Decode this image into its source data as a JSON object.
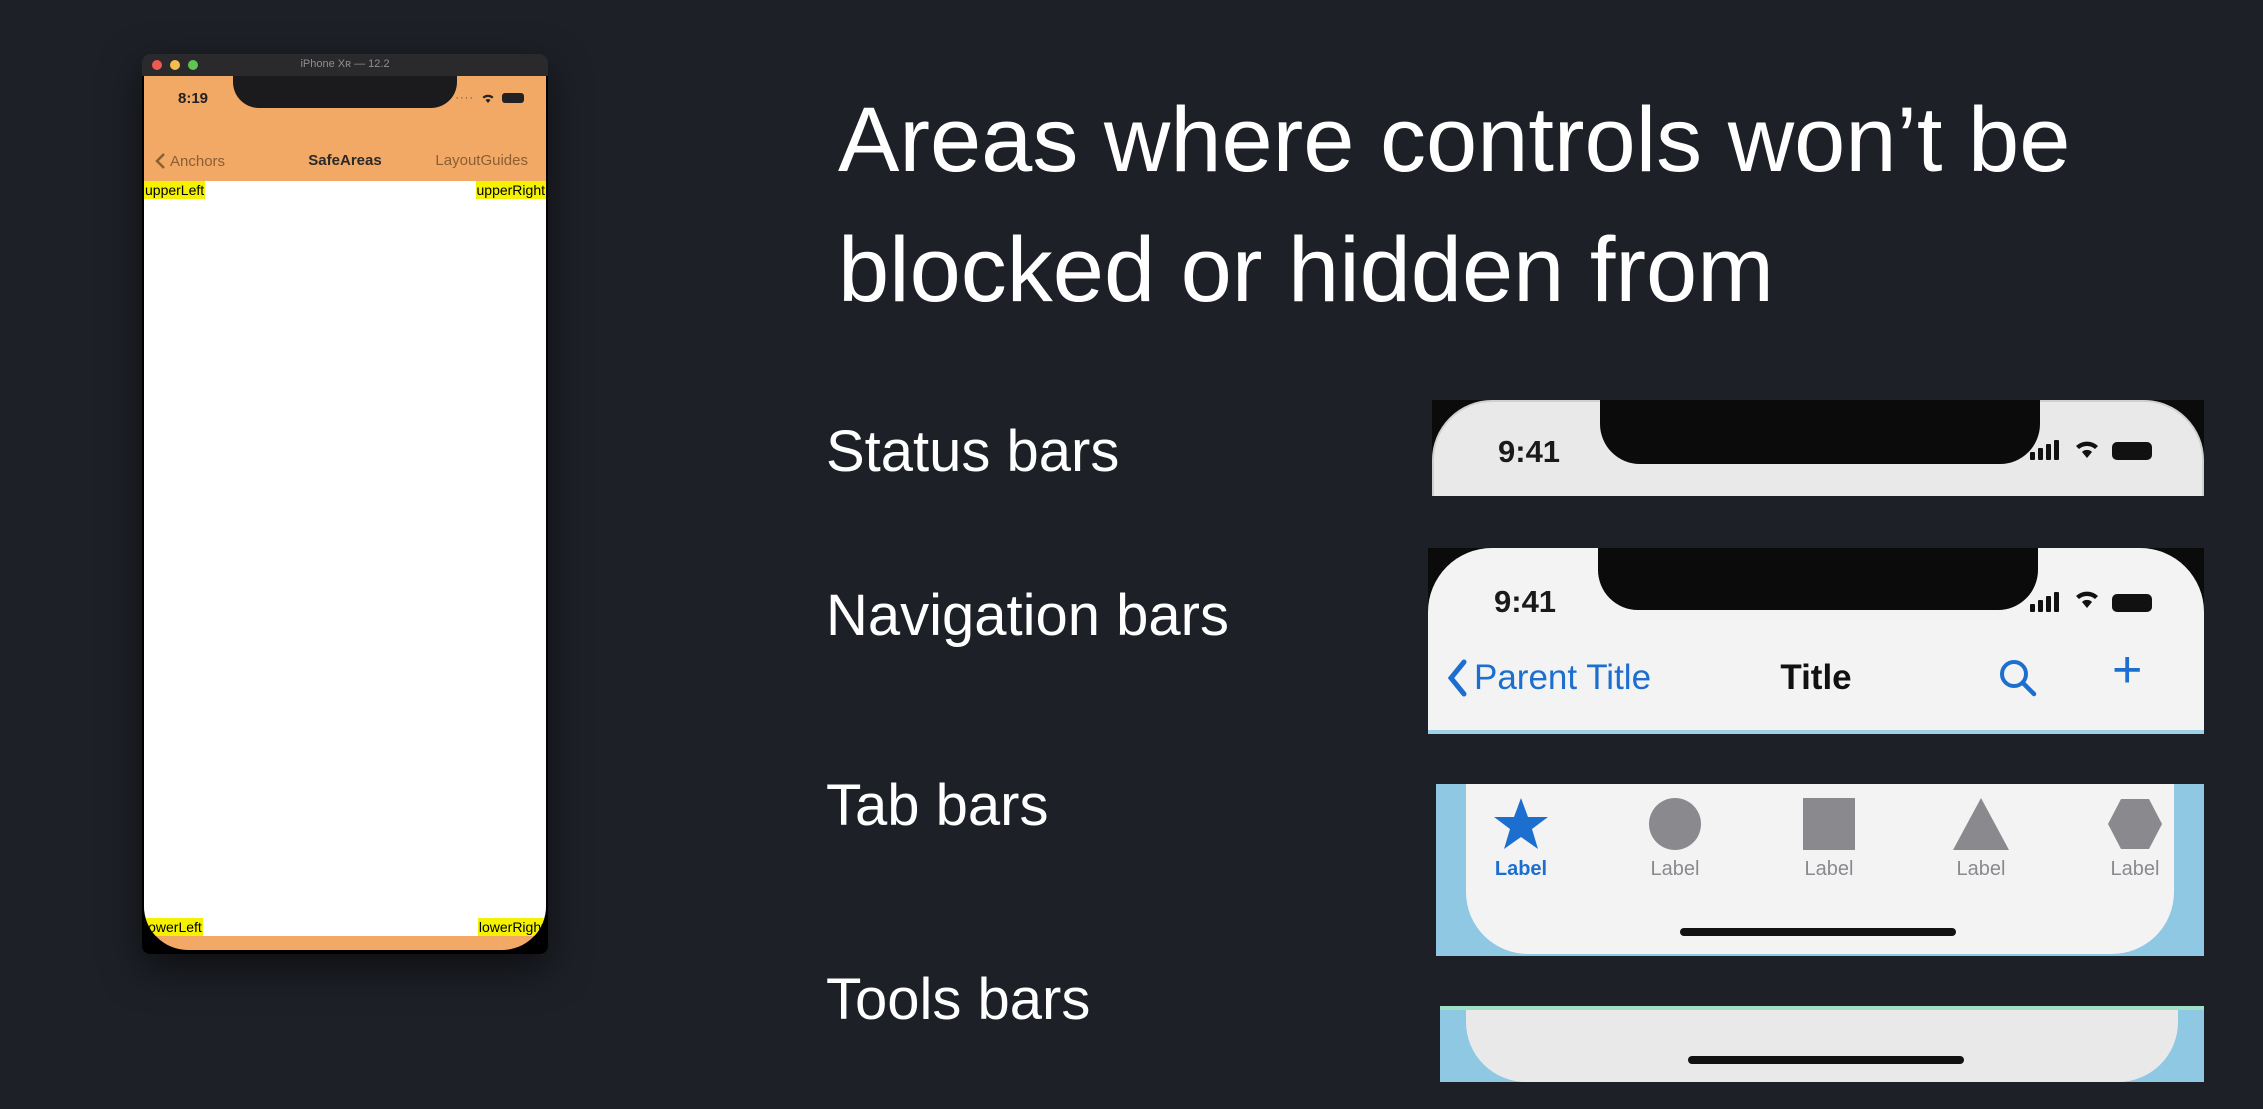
{
  "simulator": {
    "window_title": "iPhone Xʀ — 12.2",
    "time": "8:19",
    "nav": {
      "back_label": "Anchors",
      "title": "SafeAreas",
      "right_label": "LayoutGuides"
    },
    "corners": {
      "upper_left": "upperLeft",
      "upper_right": "upperRight",
      "lower_left": "lowerLeft",
      "lower_right": "lowerRight"
    },
    "colors": {
      "bar": "#f2a965",
      "corner_label_bg": "#f5f200"
    }
  },
  "slide": {
    "headline_line1": "Areas where controls won’t be",
    "headline_line2": "blocked or hidden from",
    "labels": {
      "status": "Status bars",
      "navigation": "Navigation bars",
      "tab": "Tab bars",
      "tools": "Tools bars"
    }
  },
  "illustrations": {
    "status_time": "9:41",
    "nav_time": "9:41",
    "nav_back_label": "Parent Title",
    "nav_title": "Title",
    "tab_items": [
      "Label",
      "Label",
      "Label",
      "Label",
      "Label"
    ],
    "tab_icons": [
      "star-icon",
      "circle-icon",
      "square-icon",
      "triangle-icon",
      "hexagon-icon"
    ],
    "accent_color": "#1c6fce"
  }
}
